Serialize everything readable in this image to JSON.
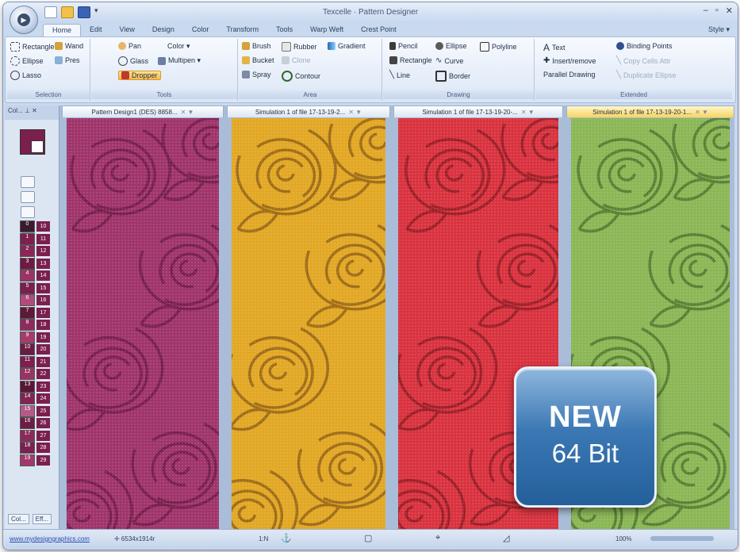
{
  "app": {
    "title": "Texcelle · Pattern Designer",
    "window_controls": [
      "–",
      "▫",
      "✕"
    ],
    "style_menu": "Style ▾"
  },
  "ribbon": {
    "tabs": [
      "Home",
      "Edit",
      "View",
      "Design",
      "Color",
      "Transform",
      "Tools",
      "Warp Weft",
      "Crest Point"
    ],
    "active_tab": "Home",
    "groups": [
      {
        "label": "Selection",
        "items": [
          "Rectangle",
          "Wand",
          "Ellipse",
          "Pres",
          "Lasso"
        ]
      },
      {
        "label": "Tools",
        "items": [
          "Pan",
          "Color ▾",
          "Glass",
          "Multipen ▾",
          "Dropper"
        ]
      },
      {
        "label": "Area",
        "items": [
          "Brush",
          "Rubber",
          "Gradient",
          "Bucket",
          "Clone",
          "Spray",
          "Contour"
        ]
      },
      {
        "label": "Drawing",
        "items": [
          "Pencil",
          "Ellipse",
          "Polyline",
          "Rectangle",
          "Curve",
          "Line",
          "Border"
        ]
      },
      {
        "label": "Extended",
        "items": [
          "Text",
          "Binding Points",
          "Insert/remove",
          "Copy Cells Attr",
          "Parallel Drawing",
          "Duplicate Ellipse"
        ]
      }
    ]
  },
  "left_panel": {
    "tab_label": "Col...  ⊥  ✕",
    "bottom_tabs": [
      "Col...",
      "Eff..."
    ],
    "color_numbers": [
      "0",
      "1",
      "2",
      "3",
      "4",
      "5",
      "6",
      "7",
      "8",
      "9",
      "10",
      "11",
      "12",
      "13",
      "14",
      "15",
      "16",
      "17",
      "18",
      "19"
    ],
    "color_labels": [
      "10",
      "11",
      "12",
      "13",
      "14",
      "15",
      "16",
      "17",
      "18",
      "19",
      "20",
      "21",
      "22",
      "23",
      "24",
      "25",
      "26",
      "27",
      "28",
      "29"
    ],
    "colors": [
      "#3a1a2c",
      "#7d1f4f",
      "#8a2758",
      "#6e1a44",
      "#9b3465",
      "#7a1f4e",
      "#b24a7c",
      "#5e1838",
      "#8f2b5c",
      "#a63c6c",
      "#6a1c42",
      "#7d1f4f",
      "#9a3364",
      "#5a1636",
      "#822453",
      "#b45a86",
      "#6b1d45",
      "#8c2a5a",
      "#7a2150",
      "#a13a69"
    ]
  },
  "documents": [
    {
      "tab": "Pattern Design1 (DES) 8858...",
      "color": "#a0356b",
      "line": "#6b1a45"
    },
    {
      "tab": "Simulation 1 of file 17-13-19-2...",
      "color": "#e2a825",
      "line": "#8a5a14"
    },
    {
      "tab": "Simulation 1 of file 17-13-19-20-...",
      "color": "#d9333f",
      "line": "#8a1a22"
    },
    {
      "tab": "Simulation 1 of file 17-13-19-20-1...",
      "color": "#8bb756",
      "line": "#4a6e2a"
    }
  ],
  "statusbar": {
    "link": "www.mydesigngraphics.com",
    "coords": "✛ 6534x1914r",
    "mid": "1:N",
    "zoom": "100%"
  },
  "badge": {
    "line1": "NEW",
    "line2": "64 Bit"
  }
}
